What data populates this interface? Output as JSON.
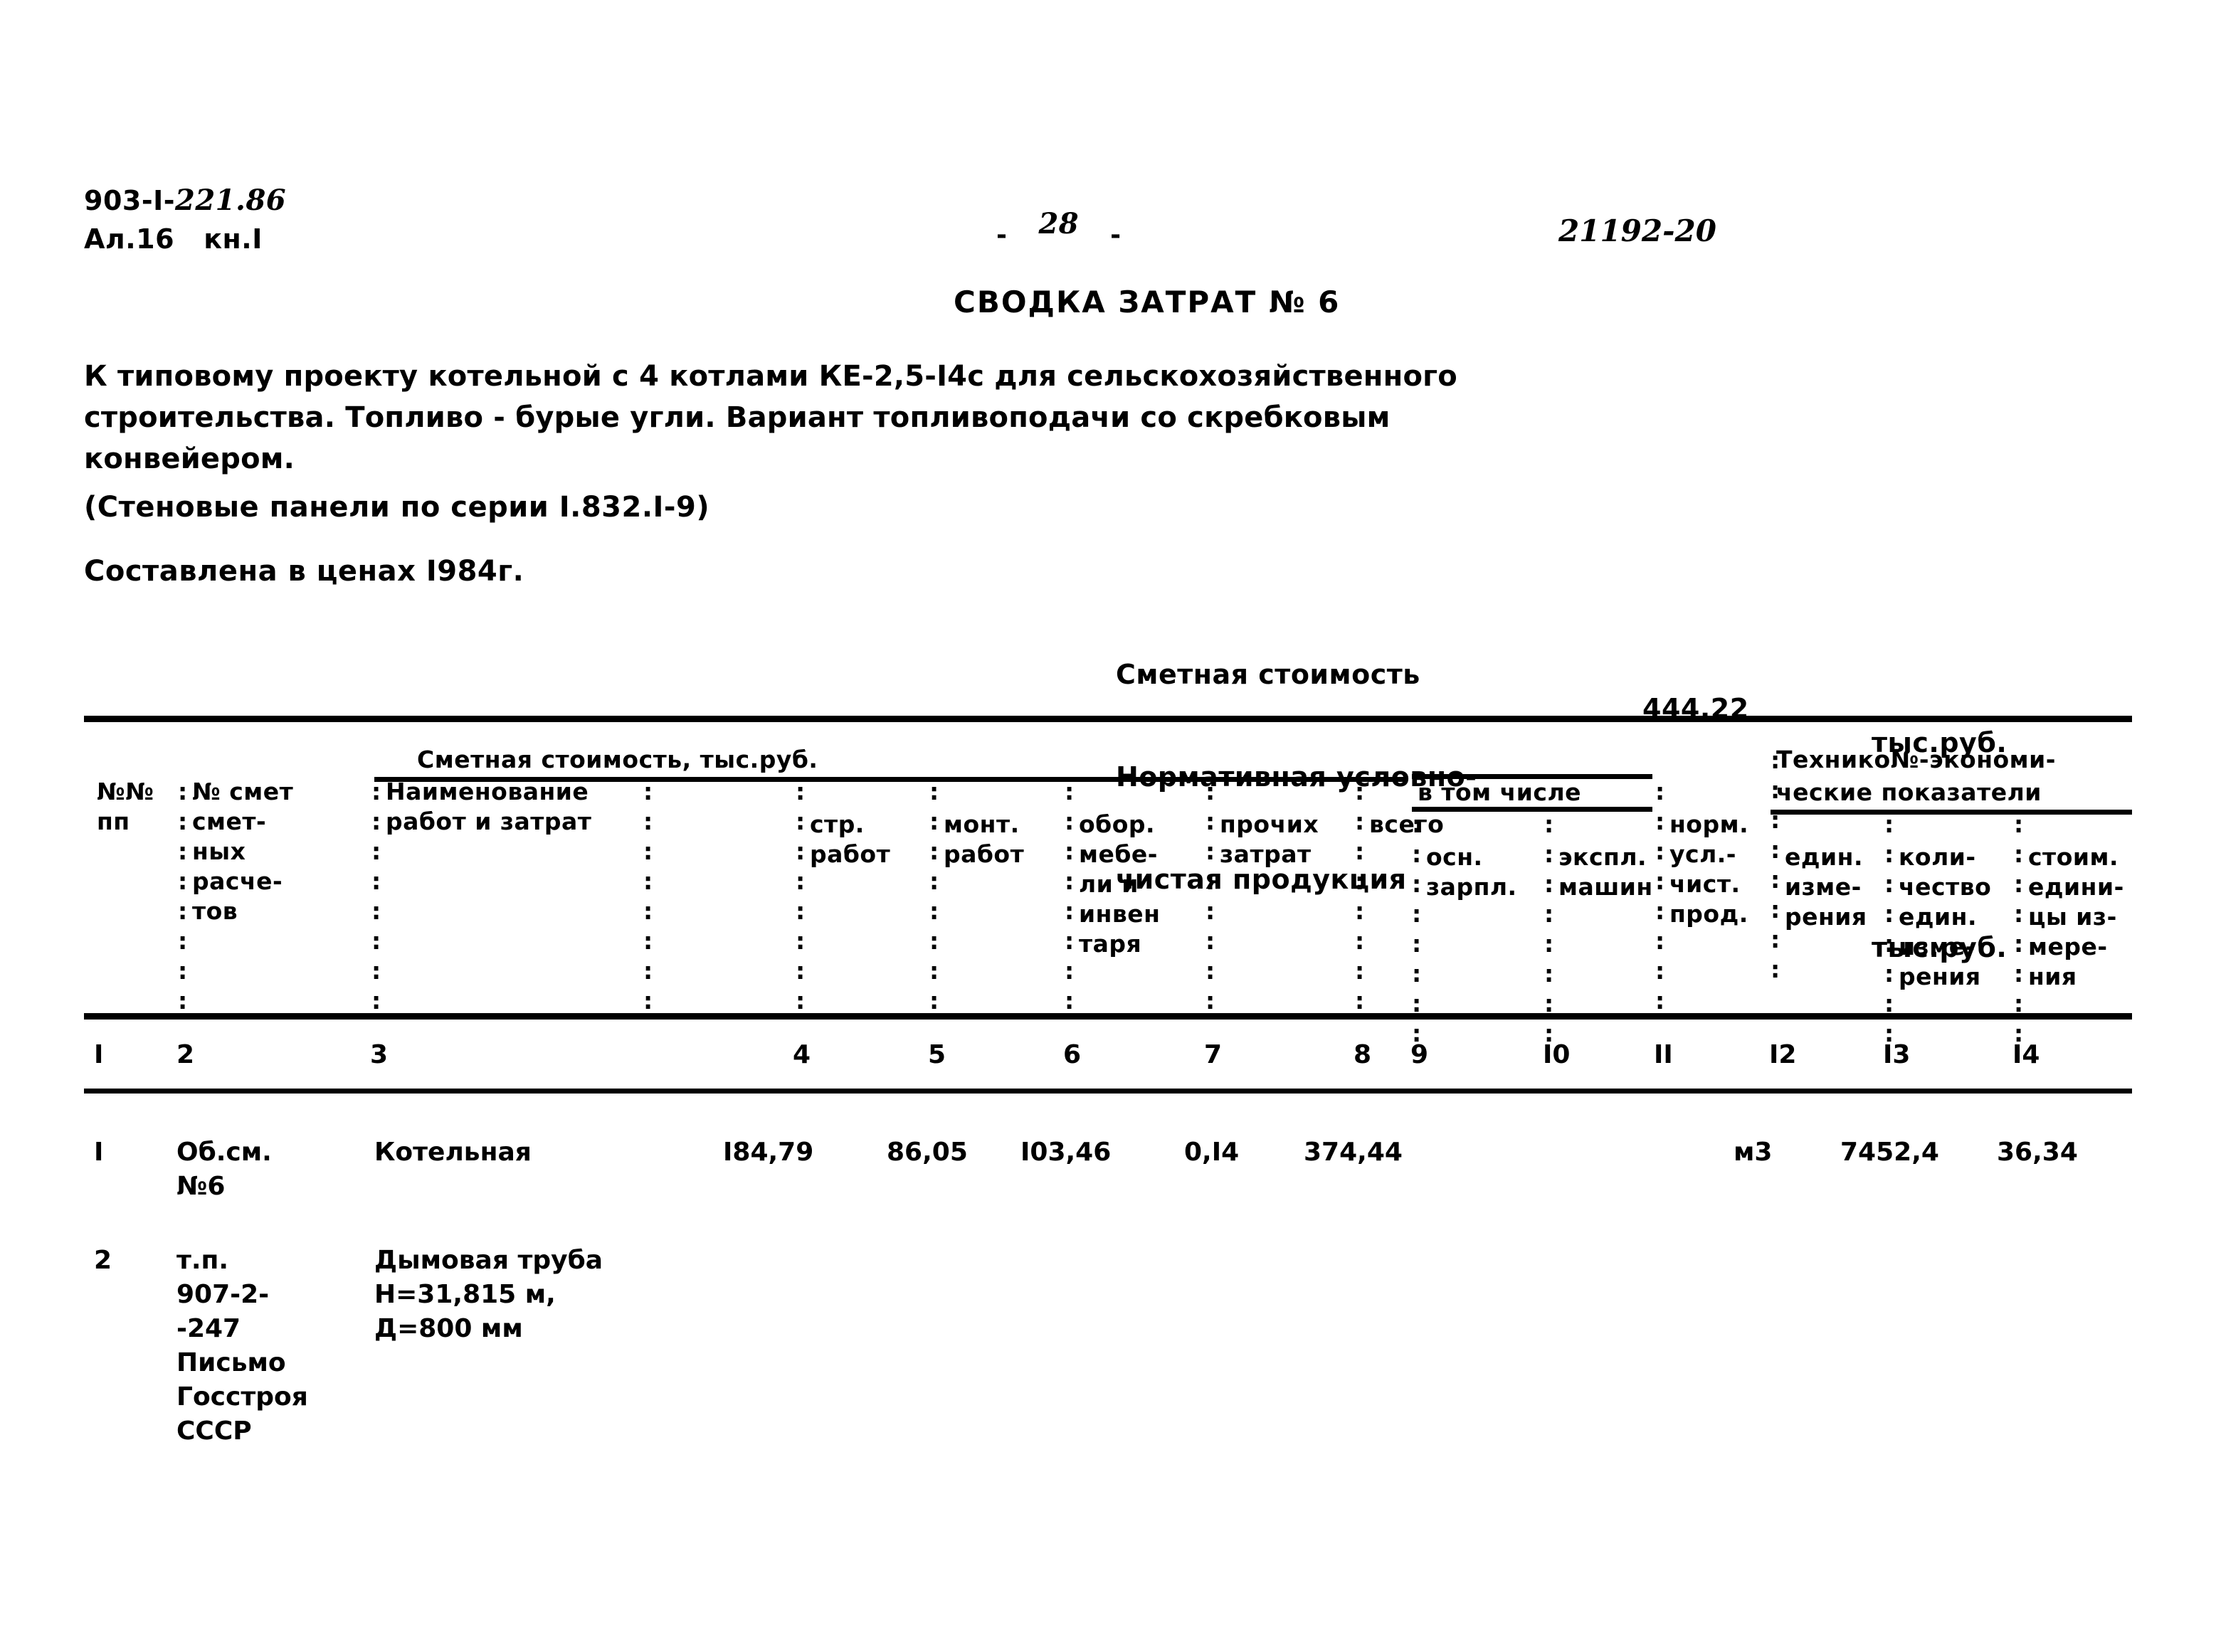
{
  "header": {
    "doc_code_prefix": "903-I-",
    "doc_code_number": "221.86",
    "album_line": "Ал.16   кн.I",
    "page_dash_left": "-",
    "page_number": "28",
    "page_dash_right": "-",
    "sheet_code": "21192-20",
    "title": "СВОДКА ЗАТРАТ № 6"
  },
  "description": {
    "line1": "К типовому проекту котельной с 4 котлами КЕ-2,5-I4с для сельскохозяйственного",
    "line2": "строительства. Топливо - бурые угли. Вариант топливоподачи со скребковым",
    "line3": "конвейером.",
    "series_note": "(Стеновые панели по серии I.832.I-9)",
    "price_base": "Составлена в ценах I984г."
  },
  "cost_summary": {
    "estimate_label": "Сметная стоимость",
    "estimate_value": "444,22",
    "estimate_unit": "тыс.руб.",
    "ncp_label_line1": "Нормативная условно-",
    "ncp_label_line2": "чистая продукция",
    "ncp_value": "",
    "ncp_unit": "тыс.руб."
  },
  "table": {
    "group_headers": {
      "cost_group": "Сметная стоимость, тыс.руб.",
      "included_group": "в том числе",
      "tech_group_line1": "Технико№-экономи-",
      "tech_group_line2": "ческие показатели"
    },
    "columns": [
      {
        "num": "I",
        "lines": [
          "№№",
          "пп"
        ]
      },
      {
        "num": "2",
        "lines": [
          "№ смет",
          "смет-",
          "ных",
          "расче-",
          "тов"
        ]
      },
      {
        "num": "3",
        "lines": [
          "Наименование",
          "работ и затрат"
        ]
      },
      {
        "num": "4",
        "lines": [
          "стр.",
          "работ"
        ]
      },
      {
        "num": "5",
        "lines": [
          "монт.",
          "работ"
        ]
      },
      {
        "num": "6",
        "lines": [
          "обор.",
          "мебе-",
          "ли и",
          "инвен",
          "таря"
        ]
      },
      {
        "num": "7",
        "lines": [
          "прочих",
          "затрат"
        ]
      },
      {
        "num": "8",
        "lines": [
          "всего"
        ]
      },
      {
        "num": "9",
        "lines": [
          "осн.",
          "зарпл."
        ]
      },
      {
        "num": "I0",
        "lines": [
          "экспл.",
          "машин"
        ]
      },
      {
        "num": "II",
        "lines": [
          "норм.",
          "усл.-",
          "чист.",
          "прод."
        ]
      },
      {
        "num": "I2",
        "lines": [
          "един.",
          "изме-",
          "рения"
        ]
      },
      {
        "num": "I3",
        "lines": [
          "коли-",
          "чество",
          "един.",
          "изме-",
          "рения"
        ]
      },
      {
        "num": "I4",
        "lines": [
          "стоим.",
          "едини-",
          "цы из-",
          "мере-",
          "ния"
        ]
      }
    ],
    "rows": [
      {
        "c1": "I",
        "c2_line1": "Об.см.",
        "c2_line2": "№6",
        "c3_line1": "Котельная",
        "c3_line2": "",
        "c3_line3": "",
        "c4": "I84,79",
        "c5": "86,05",
        "c6": "I03,46",
        "c7": "0,I4",
        "c8": "374,44",
        "c9": "",
        "c10": "",
        "c11": "",
        "c12": "м3",
        "c13": "7452,4",
        "c14": "36,34"
      },
      {
        "c1": "2",
        "c2_line1": "т.п.",
        "c2_line2": "907-2-",
        "c2_line3": "-247",
        "c2_line4": "Письмо",
        "c2_line5": "Госстроя",
        "c2_line6": "СССР",
        "c3_line1": "Дымовая труба",
        "c3_line2": "H=31,815 м,",
        "c3_line3": "Д=800 мм",
        "c4": "",
        "c5": "",
        "c6": "",
        "c7": "",
        "c8": "",
        "c9": "",
        "c10": "",
        "c11": "",
        "c12": "",
        "c13": "",
        "c14": ""
      }
    ]
  },
  "separator_glyph": ":\n:\n:\n:\n:\n:\n:\n:"
}
